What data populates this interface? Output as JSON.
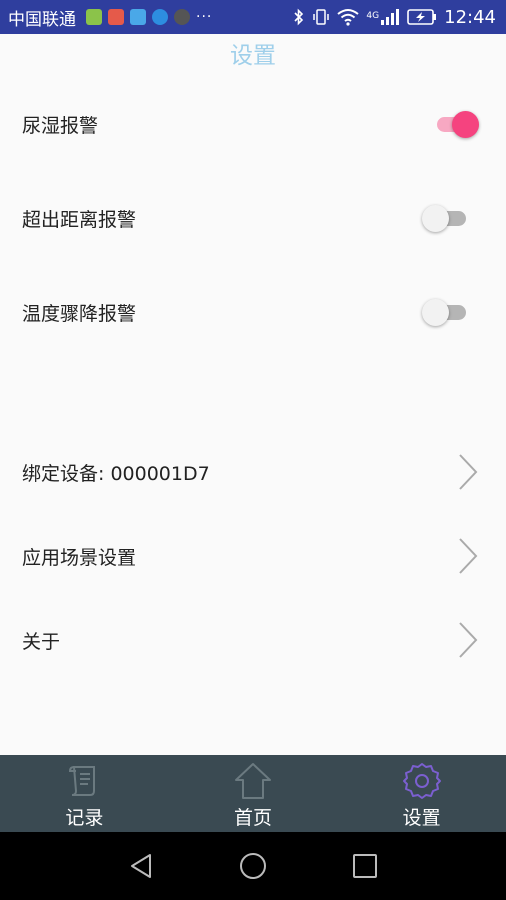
{
  "status_bar": {
    "carrier": "中国联通",
    "overflow": "···",
    "network": "4G",
    "time": "12:44"
  },
  "header": {
    "title": "设置"
  },
  "settings": {
    "toggles": [
      {
        "label": "尿湿报警",
        "enabled": true
      },
      {
        "label": "超出距离报警",
        "enabled": false
      },
      {
        "label": "温度骤降报警",
        "enabled": false
      }
    ],
    "links": [
      {
        "label": "绑定设备: 000001D7"
      },
      {
        "label": "应用场景设置"
      },
      {
        "label": "关于"
      }
    ]
  },
  "bottom_nav": {
    "items": [
      {
        "label": "记录",
        "icon": "record-icon",
        "active": false
      },
      {
        "label": "首页",
        "icon": "home-icon",
        "active": false
      },
      {
        "label": "设置",
        "icon": "gear-icon",
        "active": true
      }
    ]
  },
  "colors": {
    "status_bar": "#2f3e9e",
    "title": "#9fcfea",
    "toggle_on": "#f5437f",
    "nav_bg": "#3a4a52",
    "active_icon": "#7b5fd0"
  }
}
